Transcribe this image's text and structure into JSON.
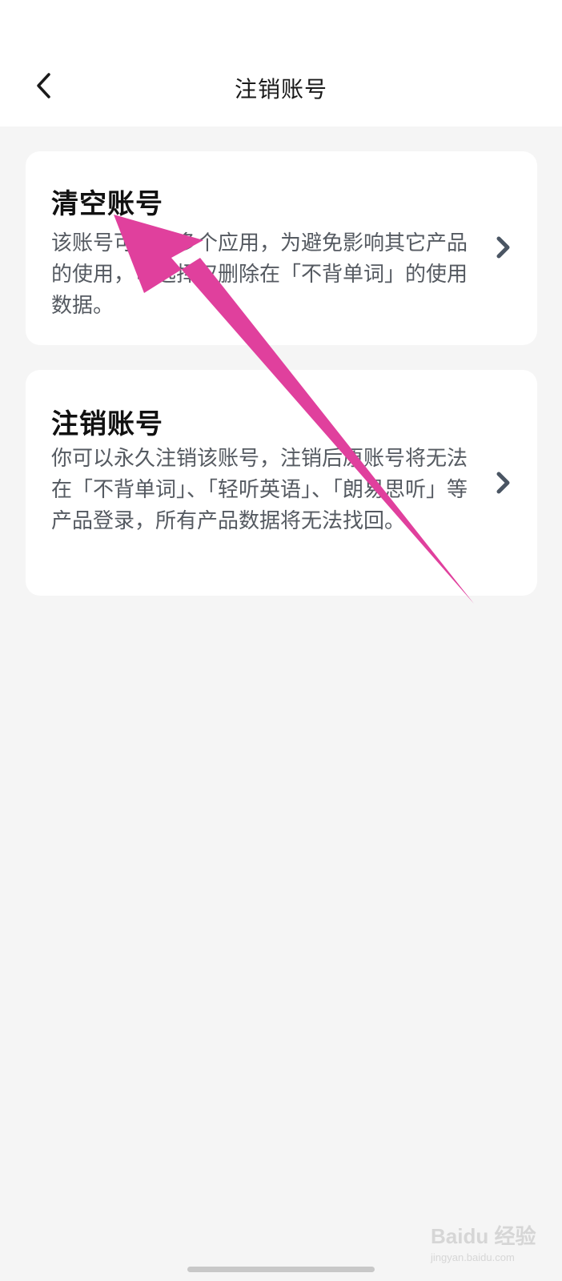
{
  "header": {
    "title": "注销账号",
    "back_icon": "chevron-left-icon"
  },
  "options": [
    {
      "title": "清空账号",
      "description": "该账号可被词多个应用，为避免影响其它产品的使用，可选择仅删除在「不背单词」的使用数据。",
      "icon": "chevron-right-icon"
    },
    {
      "title": "注销账号",
      "description": "你可以永久注销该账号，注销后原账号将无法在「不背单词」、「轻听英语」、「朗易思听」等产品登录，所有产品数据将无法找回。",
      "icon": "chevron-right-icon"
    }
  ],
  "watermark": {
    "main": "Baidu 经验",
    "sub": "jingyan.baidu.com"
  },
  "colors": {
    "background": "#f5f5f5",
    "card": "#ffffff",
    "annotation_arrow": "#e0409d",
    "chevron": "#4a5563"
  }
}
